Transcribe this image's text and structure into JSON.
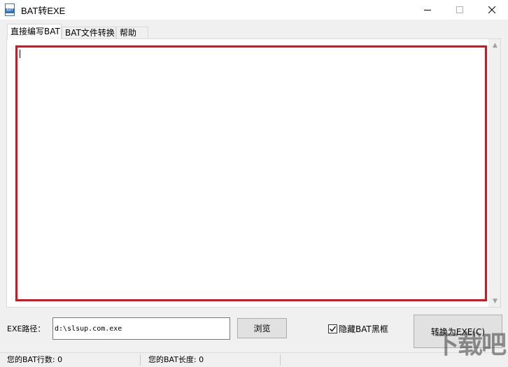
{
  "window": {
    "title": "BAT转EXE",
    "icon_band_text": "BAT"
  },
  "tabs": [
    {
      "label": "直接编写BAT",
      "active": true
    },
    {
      "label": "BAT文件转换",
      "active": false
    },
    {
      "label": "帮助",
      "active": false
    }
  ],
  "editor": {
    "content": "",
    "border_color": "#d9141c"
  },
  "path": {
    "label": "EXE路径：",
    "value": "d:\\slsup.com.exe"
  },
  "buttons": {
    "browse": "浏览",
    "convert": "转换为EXE(C)"
  },
  "options": {
    "hide_console_label": "隐藏BAT黑框",
    "hide_console_checked": true
  },
  "status": {
    "line_count": "您的BAT行数: 0",
    "length": "您的BAT长度: 0"
  },
  "watermark": {
    "text": "下载吧"
  },
  "colors": {
    "accent": "#2e6fc2",
    "chrome": "#f0f0f0"
  }
}
